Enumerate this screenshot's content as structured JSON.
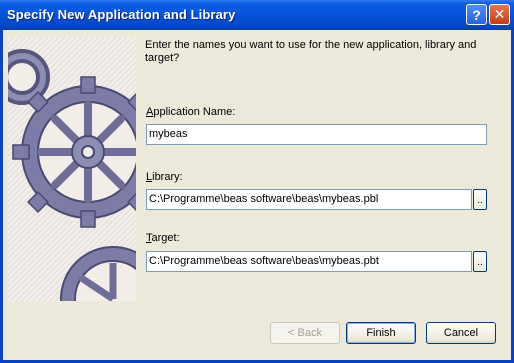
{
  "window": {
    "title": "Specify New Application and Library",
    "help_glyph": "?",
    "close_glyph": "✕"
  },
  "prompt": "Enter the names you want to use for the new application, library and target?",
  "fields": {
    "application": {
      "label_pre": "",
      "label_key": "A",
      "label_post": "pplication Name:",
      "value": "mybeas"
    },
    "library": {
      "label_pre": "",
      "label_key": "L",
      "label_post": "ibrary:",
      "value": "C:\\Programme\\beas software\\beas\\mybeas.pbl",
      "browse": ".."
    },
    "target": {
      "label_pre": "",
      "label_key": "T",
      "label_post": "arget:",
      "value": "C:\\Programme\\beas software\\beas\\mybeas.pbt",
      "browse": ".."
    }
  },
  "buttons": {
    "back": "< Back",
    "finish": "Finish",
    "cancel": "Cancel"
  },
  "colors": {
    "title_bar": "#0752d8",
    "dialog_bg": "#ece9d8",
    "gear": "#6a6a94"
  },
  "icons": {
    "art": "gear-illustration"
  }
}
